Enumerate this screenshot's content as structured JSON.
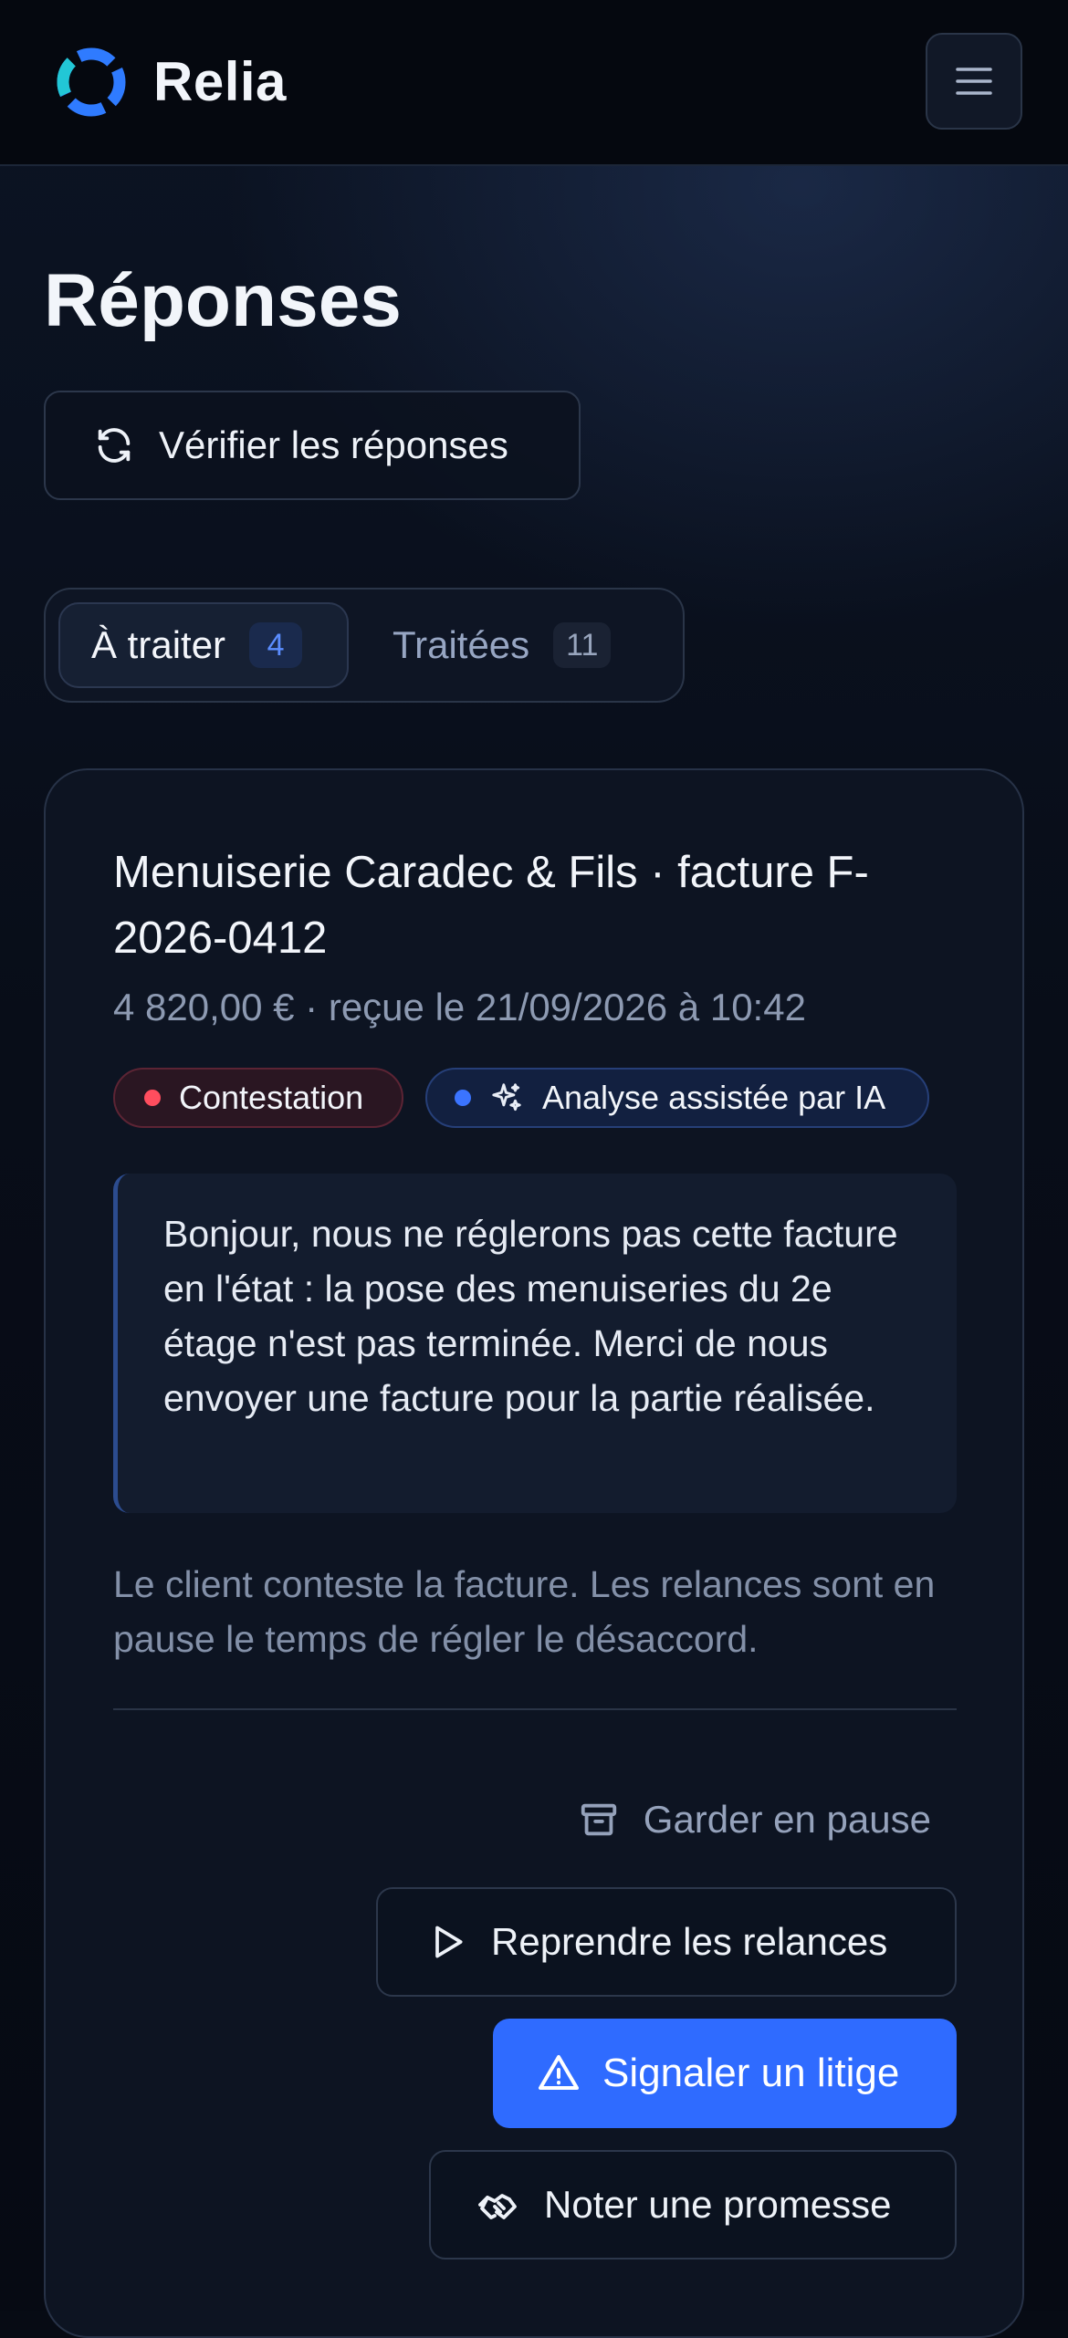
{
  "app": {
    "brand_name": "Relia",
    "logo_icon": "ring-logo-icon",
    "menu_icon": "hamburger-menu-icon"
  },
  "page": {
    "title": "Réponses",
    "verify_button": {
      "label": "Vérifier les réponses",
      "icon": "refresh-icon"
    }
  },
  "tabs": [
    {
      "label": "À traiter",
      "count": "4",
      "active": true
    },
    {
      "label": "Traitées",
      "count": "11",
      "active": false
    }
  ],
  "card": {
    "title": "Menuiserie Caradec & Fils · facture F-2026-0412",
    "meta": "4 820,00 € · reçue le 21/09/2026 à 10:42",
    "chips": {
      "dispute": "Contestation",
      "ai": "Analyse assistée par IA",
      "ai_icon": "sparkles-icon"
    },
    "quote": "Bonjour, nous ne réglerons pas cette facture en l'état : la pose des menuiseries du 2e étage n'est pas terminée. Merci de nous envoyer une facture pour la partie réalisée.",
    "note": "Le client conteste la facture. Les relances sont en pause le temps de régler le désaccord.",
    "actions": {
      "keep_paused": {
        "label": "Garder en pause",
        "icon": "archive-box-icon"
      },
      "resume": {
        "label": "Reprendre les relances",
        "icon": "play-icon"
      },
      "dispute": {
        "label": "Signaler un litige",
        "icon": "warning-triangle-icon"
      },
      "promise": {
        "label": "Noter une promesse",
        "icon": "handshake-icon"
      }
    }
  },
  "colors": {
    "accent_blue": "#2f6bff",
    "dispute_red": "#ff4d5e",
    "ai_blue": "#3b74ff",
    "logo_cyan": "#22c7d6",
    "logo_blue": "#2f7bff"
  }
}
